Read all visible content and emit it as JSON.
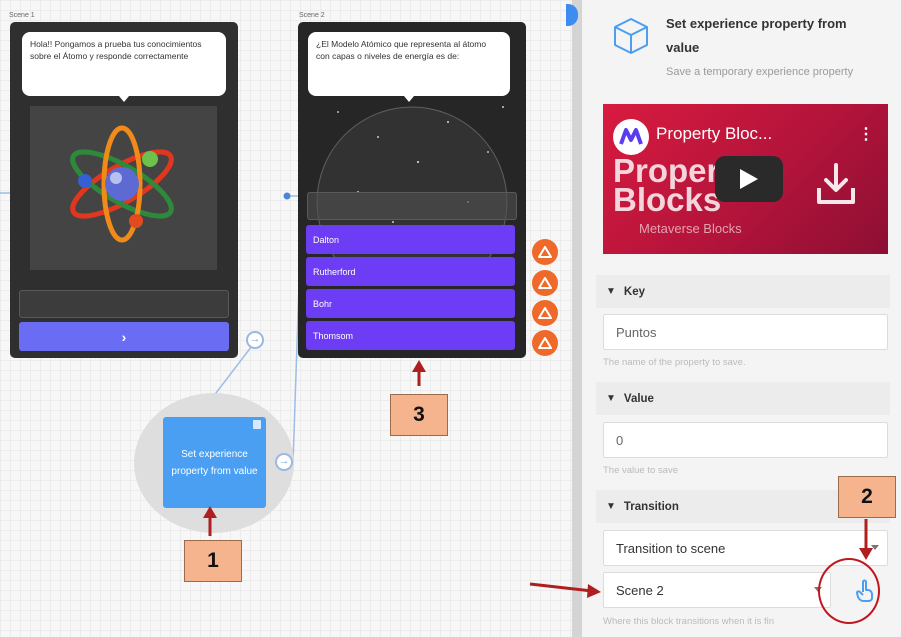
{
  "scene1": {
    "label": "Scene 1",
    "bubble_text": "Hola!! Pongamos a prueba tus conocimientos sobre el Átomo y responde correctamente",
    "next_glyph": "›"
  },
  "scene2": {
    "label": "Scene 2",
    "bubble_text": "¿El Modelo Atómico que representa al átomo con capas o niveles de energía es de:",
    "answers": [
      "Dalton",
      "Rutherford",
      "Bohr",
      "Thomsom"
    ]
  },
  "block": {
    "label": "Set experience property from value"
  },
  "annotations": {
    "one": "1",
    "two": "2",
    "three": "3"
  },
  "panel": {
    "title": "Set experience property from value",
    "subtitle": "Save a temporary experience property",
    "video": {
      "title": "Property Bloc...",
      "big_text_line1": "Property",
      "big_text_line2": "Blocks",
      "meta": "Metaverse Blocks"
    },
    "key": {
      "heading": "Key",
      "value": "Puntos",
      "hint": "The name of the property to save."
    },
    "value": {
      "heading": "Value",
      "value": "0",
      "hint": "The value to save"
    },
    "transition": {
      "heading": "Transition",
      "mode": "Transition to scene",
      "scene": "Scene 2",
      "hint": "Where this block transitions when it is fin"
    }
  },
  "colors": {
    "accent_blue": "#4a9ff2",
    "answer_purple": "#6d3cf5",
    "warning_orange": "#ef6a2a",
    "annotation_red": "#c0171f",
    "video_red": "#d81b40"
  }
}
